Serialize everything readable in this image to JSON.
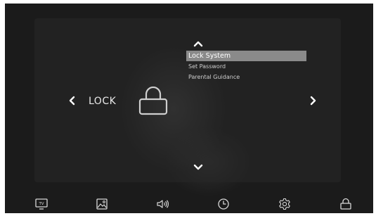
{
  "menu": {
    "title": "LOCK",
    "items": [
      {
        "label": "Lock System",
        "selected": true
      },
      {
        "label": "Set Password",
        "selected": false
      },
      {
        "label": "Parental Guidance",
        "selected": false
      }
    ]
  },
  "icons": {
    "up": "chevron-up-icon",
    "down": "chevron-down-icon",
    "left": "chevron-left-icon",
    "right": "chevron-right-icon",
    "lock": "lock-icon"
  },
  "bottom_tabs": [
    {
      "name": "tv-icon",
      "text": "TV"
    },
    {
      "name": "picture-icon"
    },
    {
      "name": "sound-icon"
    },
    {
      "name": "clock-icon"
    },
    {
      "name": "settings-icon"
    },
    {
      "name": "lock-icon",
      "active": true
    }
  ],
  "colors": {
    "background": "#1b1b1b",
    "highlight": "#8a8a8a",
    "text": "#e6e6e6"
  }
}
